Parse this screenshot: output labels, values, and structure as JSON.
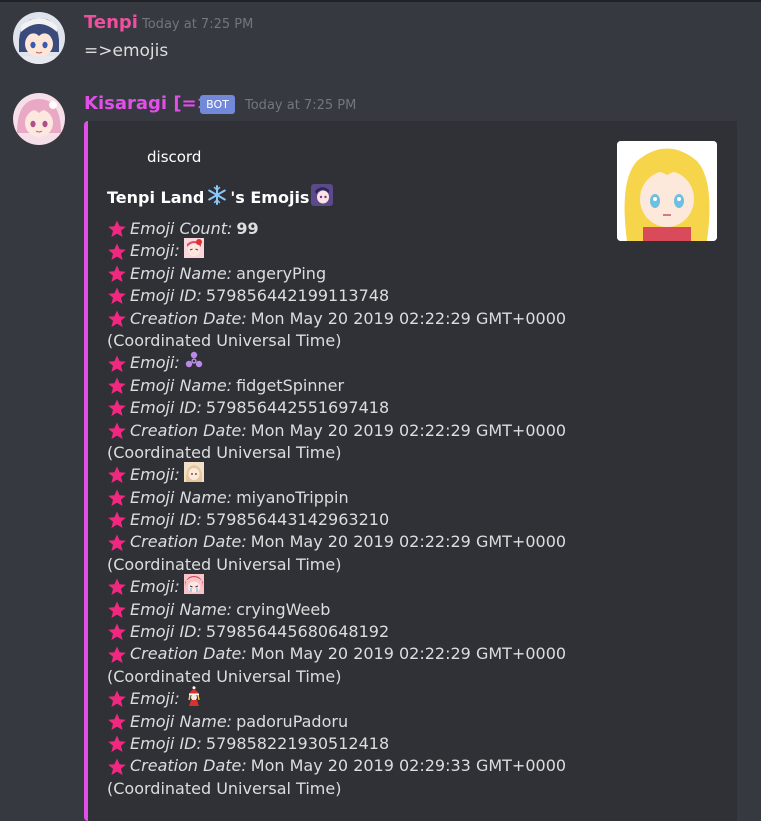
{
  "messages": [
    {
      "username": "Tenpi",
      "username_color": "#f04fa0",
      "timestamp": "Today at 7:25 PM",
      "content": "=>emojis",
      "avatar_icon": "anime-girl-avatar-icon"
    },
    {
      "username": "Kisaragi [=>]",
      "username_color": "#e24fe8",
      "bot_tag": "BOT",
      "timestamp": "Today at 7:25 PM",
      "avatar_icon": "pink-hair-anime-avatar-icon"
    }
  ],
  "embed": {
    "accent_color": "#e24fe8",
    "author": "discord",
    "title_text": "Tenpi Land",
    "title_suffix": "'s Emojis",
    "thumbnail_icon": "blonde-anime-girl-thumbnail",
    "count_label": "Emoji Count:",
    "count_value": "99",
    "emoji_label": "Emoji:",
    "name_label": "Emoji Name:",
    "id_label": "Emoji ID:",
    "date_label": "Creation Date:",
    "emojis": [
      {
        "icon": "angery-ping-emoji",
        "name": "angeryPing",
        "id": "579856442199113748",
        "date": "Mon May 20 2019 02:22:29 GMT+0000",
        "tz": "(Coordinated Universal Time)"
      },
      {
        "icon": "fidget-spinner-emoji",
        "name": "fidgetSpinner",
        "id": "579856442551697418",
        "date": "Mon May 20 2019 02:22:29 GMT+0000",
        "tz": "(Coordinated Universal Time)"
      },
      {
        "icon": "miyano-trippin-emoji",
        "name": "miyanoTrippin",
        "id": "579856443142963210",
        "date": "Mon May 20 2019 02:22:29 GMT+0000",
        "tz": "(Coordinated Universal Time)"
      },
      {
        "icon": "crying-weeb-emoji",
        "name": "cryingWeeb",
        "id": "579856445680648192",
        "date": "Mon May 20 2019 02:22:29 GMT+0000",
        "tz": "(Coordinated Universal Time)"
      },
      {
        "icon": "padoru-padoru-emoji",
        "name": "padoruPadoru",
        "id": "579858221930512418",
        "date": "Mon May 20 2019 02:29:33 GMT+0000",
        "tz": "(Coordinated Universal Time)"
      }
    ]
  }
}
